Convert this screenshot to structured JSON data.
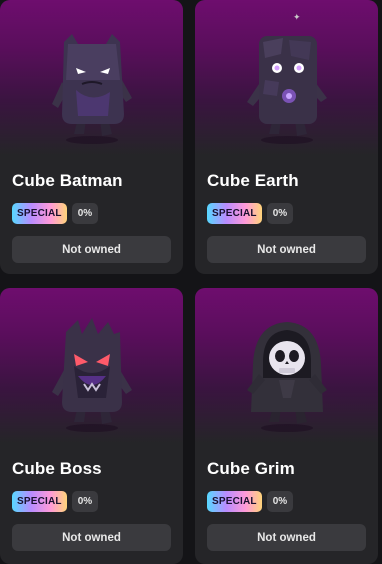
{
  "cards": [
    {
      "name": "Cube Batman",
      "rarity_label": "SPECIAL",
      "percent": "0%",
      "status_label": "Not owned",
      "icon": "cube-batman-figure-icon"
    },
    {
      "name": "Cube Earth",
      "rarity_label": "SPECIAL",
      "percent": "0%",
      "status_label": "Not owned",
      "icon": "cube-earth-figure-icon"
    },
    {
      "name": "Cube Boss",
      "rarity_label": "SPECIAL",
      "percent": "0%",
      "status_label": "Not owned",
      "icon": "cube-boss-figure-icon"
    },
    {
      "name": "Cube Grim",
      "rarity_label": "SPECIAL",
      "percent": "0%",
      "status_label": "Not owned",
      "icon": "cube-grim-figure-icon"
    }
  ],
  "colors": {
    "card_background": "#252528",
    "art_gradient_top": "#6e0d6e",
    "pill_background": "#3a3a3e",
    "special_gradient": [
      "#57d8ff",
      "#b98cff",
      "#ff9ad8",
      "#ffd47a"
    ]
  }
}
